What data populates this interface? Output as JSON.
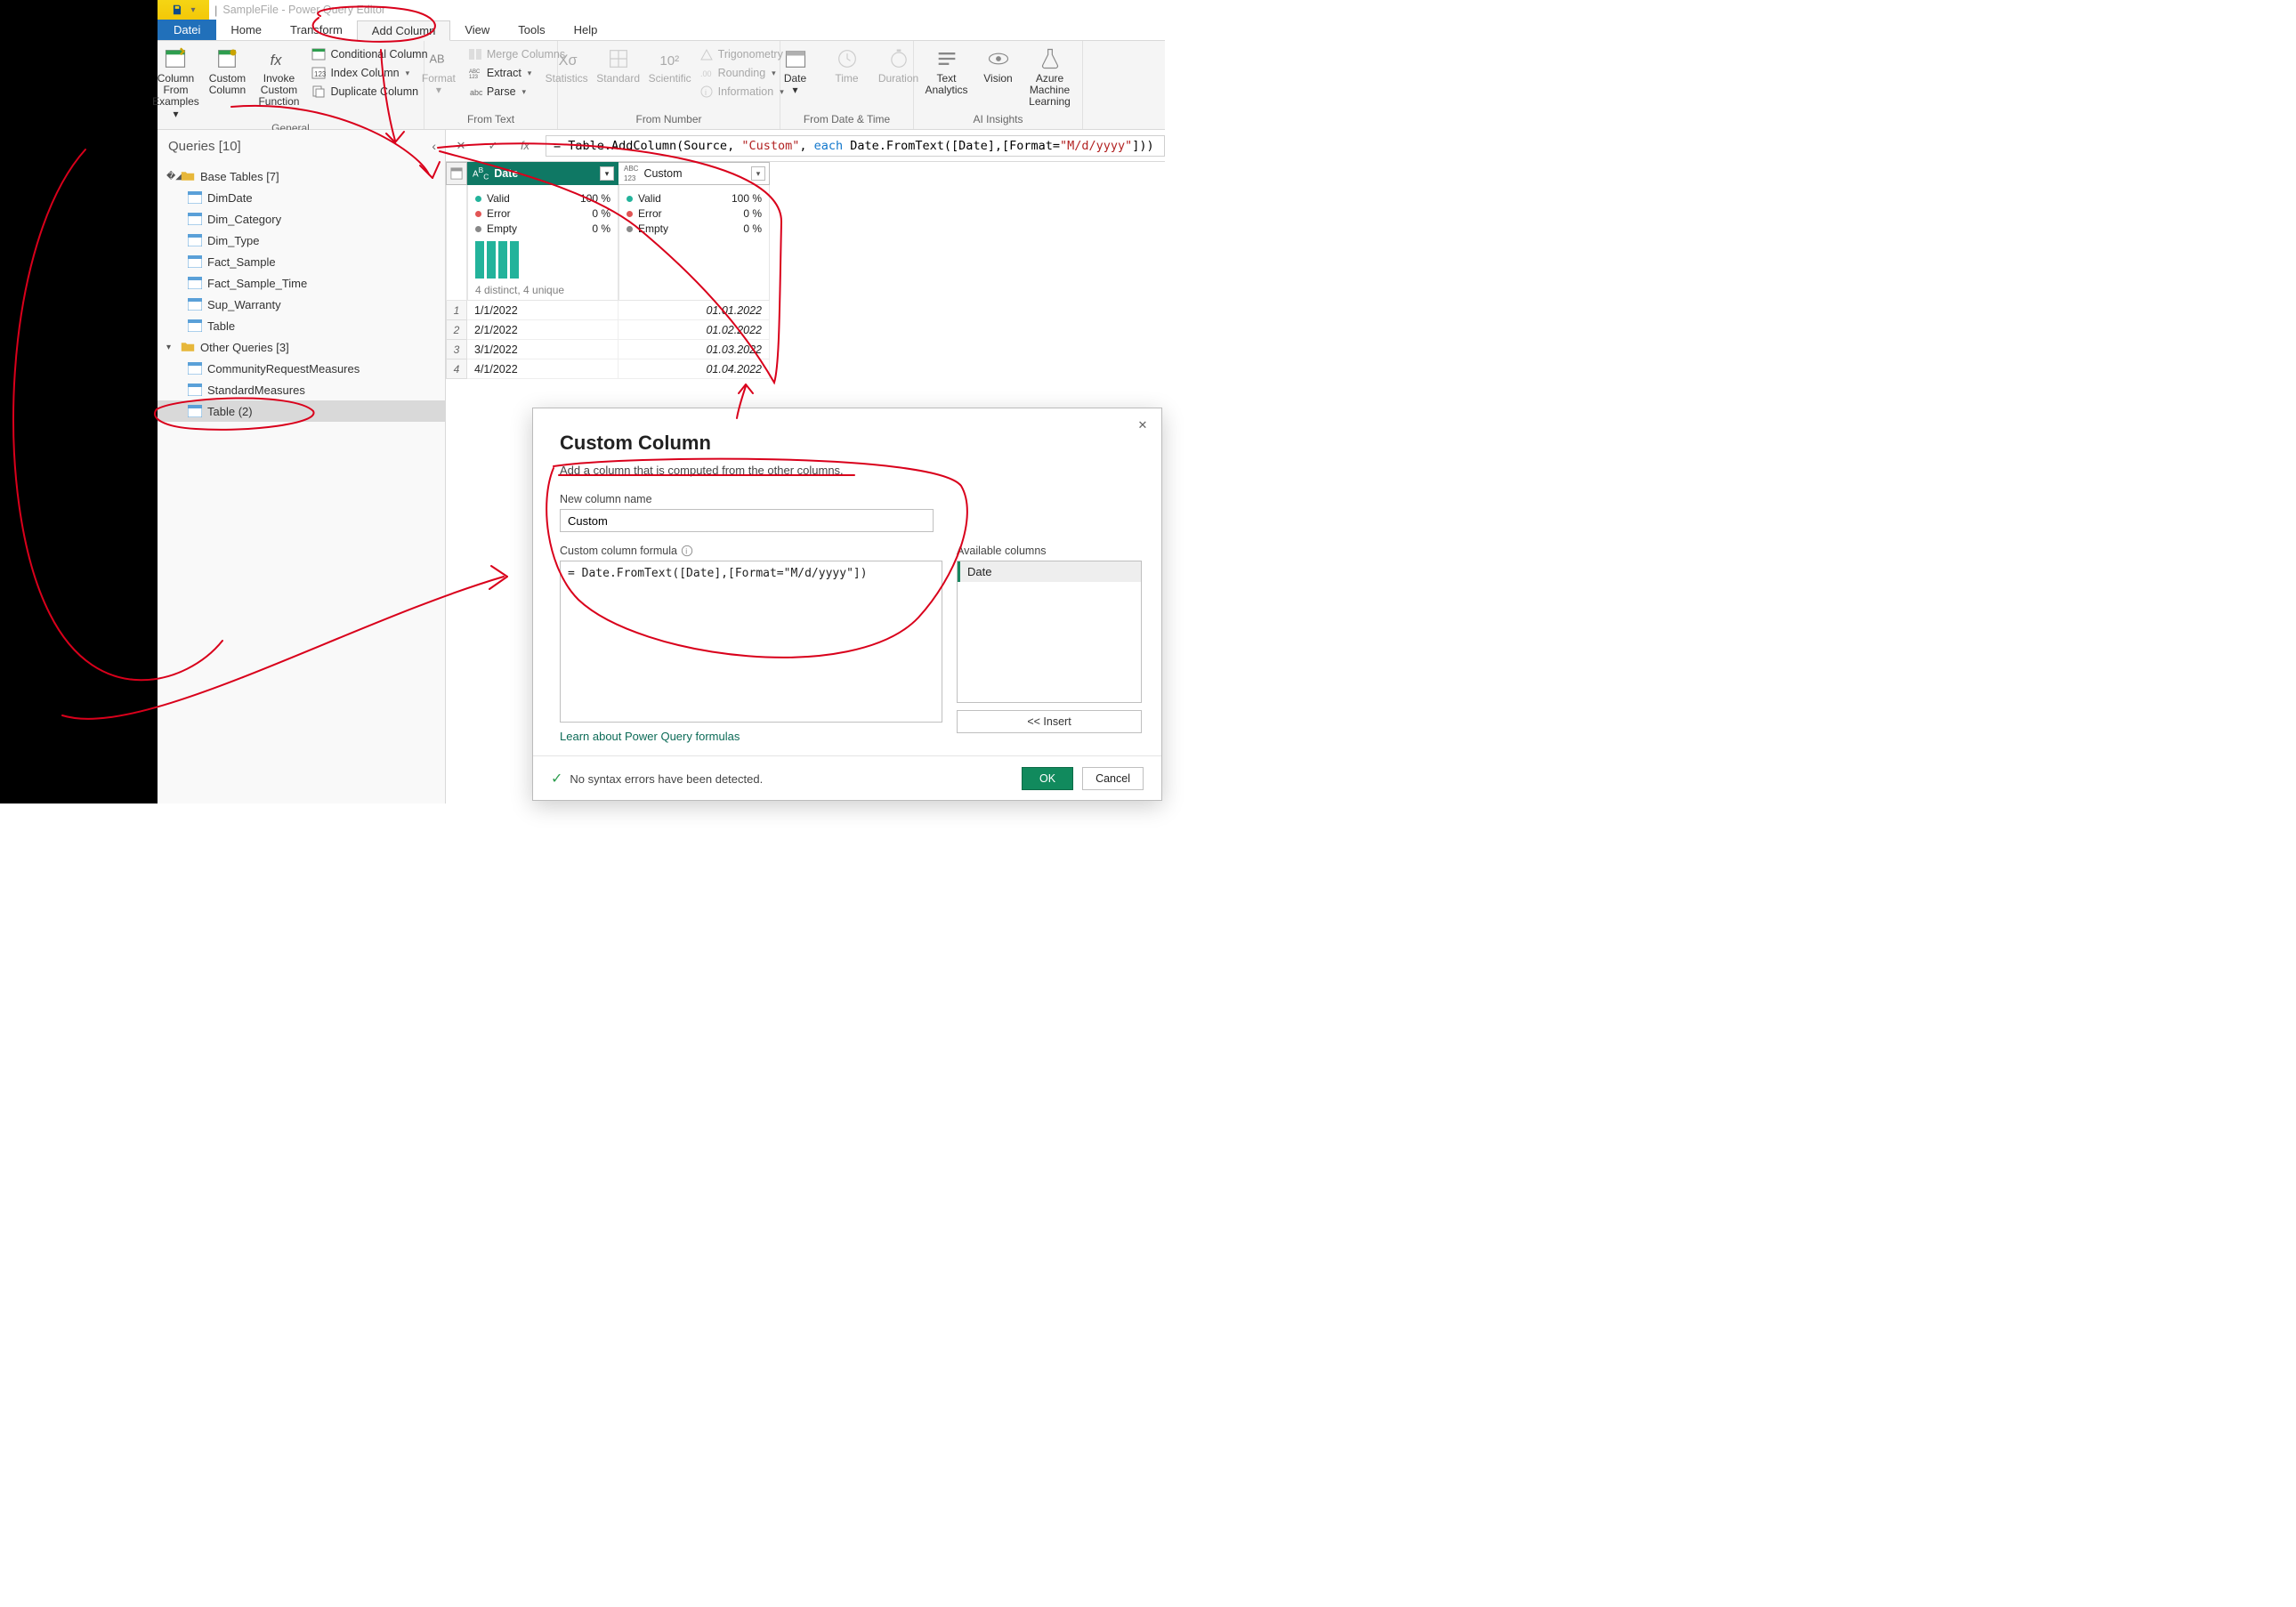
{
  "title": {
    "document": "SampleFile - Power Query Editor"
  },
  "tabs": {
    "file": "Datei",
    "home": "Home",
    "transform": "Transform",
    "addcolumn": "Add Column",
    "view": "View",
    "tools": "Tools",
    "help": "Help"
  },
  "ribbon": {
    "general": {
      "label": "General",
      "column_from_examples": "Column From Examples",
      "custom_column": "Custom Column",
      "invoke_custom_function": "Invoke Custom Function",
      "conditional_column": "Conditional Column",
      "index_column": "Index Column",
      "duplicate_column": "Duplicate Column"
    },
    "from_text": {
      "label": "From Text",
      "format": "Format",
      "merge": "Merge Columns",
      "extract": "Extract",
      "parse": "Parse"
    },
    "from_number": {
      "label": "From Number",
      "statistics": "Statistics",
      "standard": "Standard",
      "scientific": "Scientific",
      "trig": "Trigonometry",
      "rounding": "Rounding",
      "information": "Information"
    },
    "from_datetime": {
      "label": "From Date & Time",
      "date": "Date",
      "time": "Time",
      "duration": "Duration"
    },
    "ai": {
      "label": "AI Insights",
      "text_analytics": "Text Analytics",
      "vision": "Vision",
      "aml": "Azure Machine Learning"
    }
  },
  "queries_pane": {
    "title": "Queries [10]",
    "folders": [
      {
        "name": "Base Tables [7]",
        "items": [
          "DimDate",
          "Dim_Category",
          "Dim_Type",
          "Fact_Sample",
          "Fact_Sample_Time",
          "Sup_Warranty",
          "Table"
        ]
      },
      {
        "name": "Other Queries [3]",
        "items": [
          "CommunityRequestMeasures",
          "StandardMeasures",
          "Table (2)"
        ]
      }
    ],
    "selected": "Table (2)"
  },
  "formula_bar": {
    "prefix": "= Table.AddColumn(Source, ",
    "arg_str": "\"Custom\"",
    "mid": ", ",
    "each": "each",
    "body": " Date.FromText([Date],[Format=",
    "fmt": "\"M/d/yyyy\"",
    "suffix": "]))"
  },
  "grid": {
    "columns": [
      {
        "name": "Date",
        "type": "ABC",
        "selected": true
      },
      {
        "name": "Custom",
        "type": "ABC123",
        "selected": false
      }
    ],
    "quality": {
      "valid": "Valid",
      "error": "Error",
      "empty": "Empty",
      "valid_pct": "100 %",
      "zero_pct": "0 %",
      "distinct": "4 distinct, 4 unique"
    },
    "rows": [
      {
        "n": "1",
        "c1": "1/1/2022",
        "c2": "01.01.2022"
      },
      {
        "n": "2",
        "c1": "2/1/2022",
        "c2": "01.02.2022"
      },
      {
        "n": "3",
        "c1": "3/1/2022",
        "c2": "01.03.2022"
      },
      {
        "n": "4",
        "c1": "4/1/2022",
        "c2": "01.04.2022"
      }
    ]
  },
  "dialog": {
    "title": "Custom Column",
    "desc": "Add a column that is computed from the other columns.",
    "name_label": "New column name",
    "name_value": "Custom",
    "formula_label": "Custom column formula",
    "formula_value": "= Date.FromText([Date],[Format=\"M/d/yyyy\"])",
    "available_label": "Available columns",
    "available_items": [
      "Date"
    ],
    "insert": "<< Insert",
    "learn": "Learn about Power Query formulas",
    "status": "No syntax errors have been detected.",
    "ok": "OK",
    "cancel": "Cancel"
  }
}
